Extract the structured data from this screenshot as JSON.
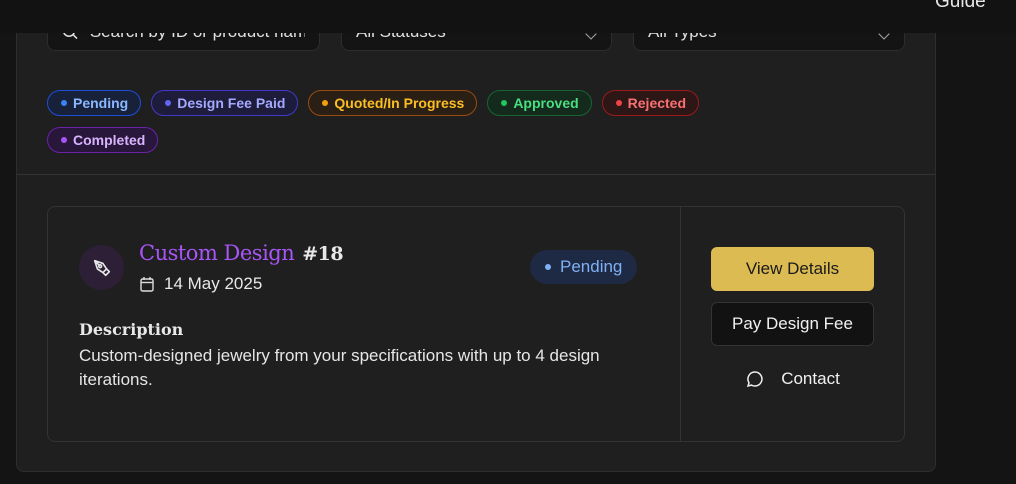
{
  "header": {
    "guide_label": "Guide"
  },
  "filters": {
    "search_placeholder": "Search by ID or product name",
    "status_value": "All Statuses",
    "type_value": "All Types"
  },
  "legend": [
    {
      "label": "Pending",
      "color": "#3b82f6",
      "text": "#8ab8ff",
      "border": "#1d4ed8",
      "bg": "#17213a"
    },
    {
      "label": "Design Fee Paid",
      "color": "#6366f1",
      "text": "#a5a8ff",
      "border": "#4338ca",
      "bg": "#1d1c3a"
    },
    {
      "label": "Quoted/In Progress",
      "color": "#f59e0b",
      "text": "#fbbf24",
      "border": "#9a4a10",
      "bg": "#2a1f14"
    },
    {
      "label": "Approved",
      "color": "#22c55e",
      "text": "#4ade80",
      "border": "#166534",
      "bg": "#142a1c"
    },
    {
      "label": "Rejected",
      "color": "#ef4444",
      "text": "#f87171",
      "border": "#991b1b",
      "bg": "#2d1616"
    },
    {
      "label": "Completed",
      "color": "#a855f7",
      "text": "#d8b4fe",
      "border": "#6b21a8",
      "bg": "#28173a"
    }
  ],
  "order": {
    "title": "Custom Design",
    "number": "#18",
    "date": "14 May 2025",
    "status": "Pending",
    "description_heading": "Description",
    "description": "Custom-designed jewelry from your specifications with up to 4 design iterations."
  },
  "actions": {
    "view": "View Details",
    "pay": "Pay Design Fee",
    "contact": "Contact"
  }
}
